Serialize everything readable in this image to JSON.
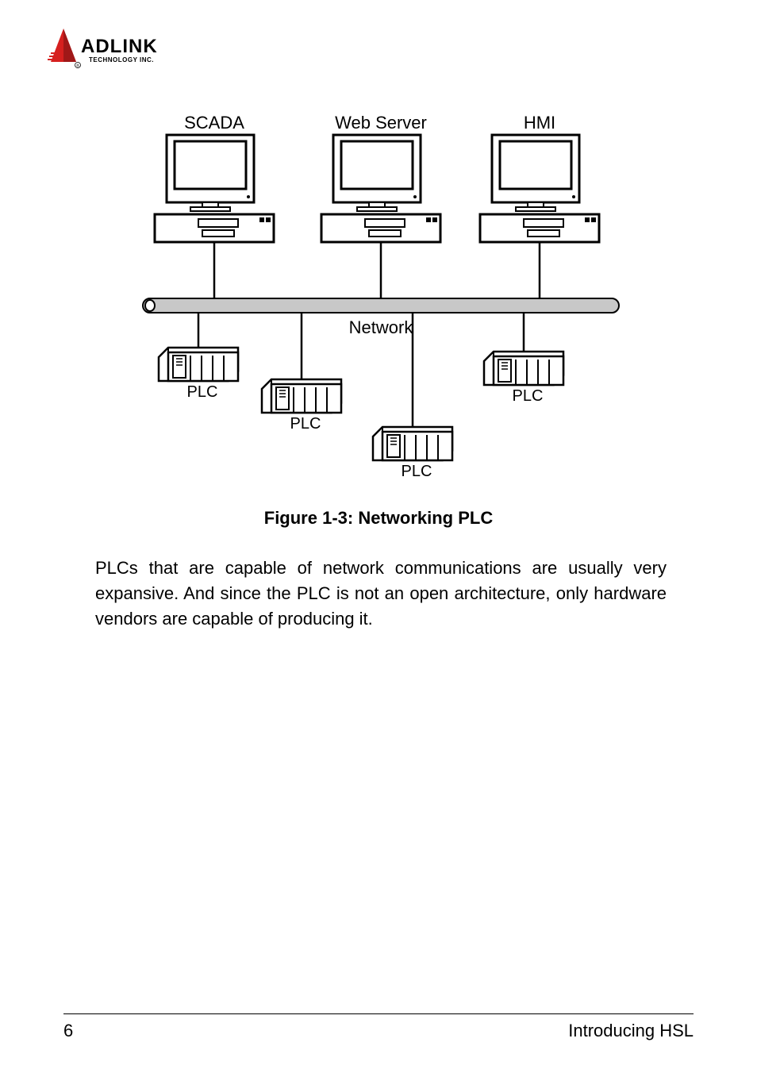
{
  "logo": {
    "brand": "ADLINK",
    "tagline": "TECHNOLOGY INC."
  },
  "diagram": {
    "top_nodes": [
      "SCADA",
      "Web Server",
      "HMI"
    ],
    "bus_label": "Network",
    "bottom_nodes": [
      "PLC",
      "PLC",
      "PLC",
      "PLC"
    ]
  },
  "figure_caption": "Figure 1-3: Networking PLC",
  "body_paragraph": "PLCs that are capable of network communications are usually very expansive. And since the PLC is not an open architecture, only hardware vendors are capable of producing it.",
  "footer": {
    "page_number": "6",
    "section": "Introducing HSL"
  }
}
